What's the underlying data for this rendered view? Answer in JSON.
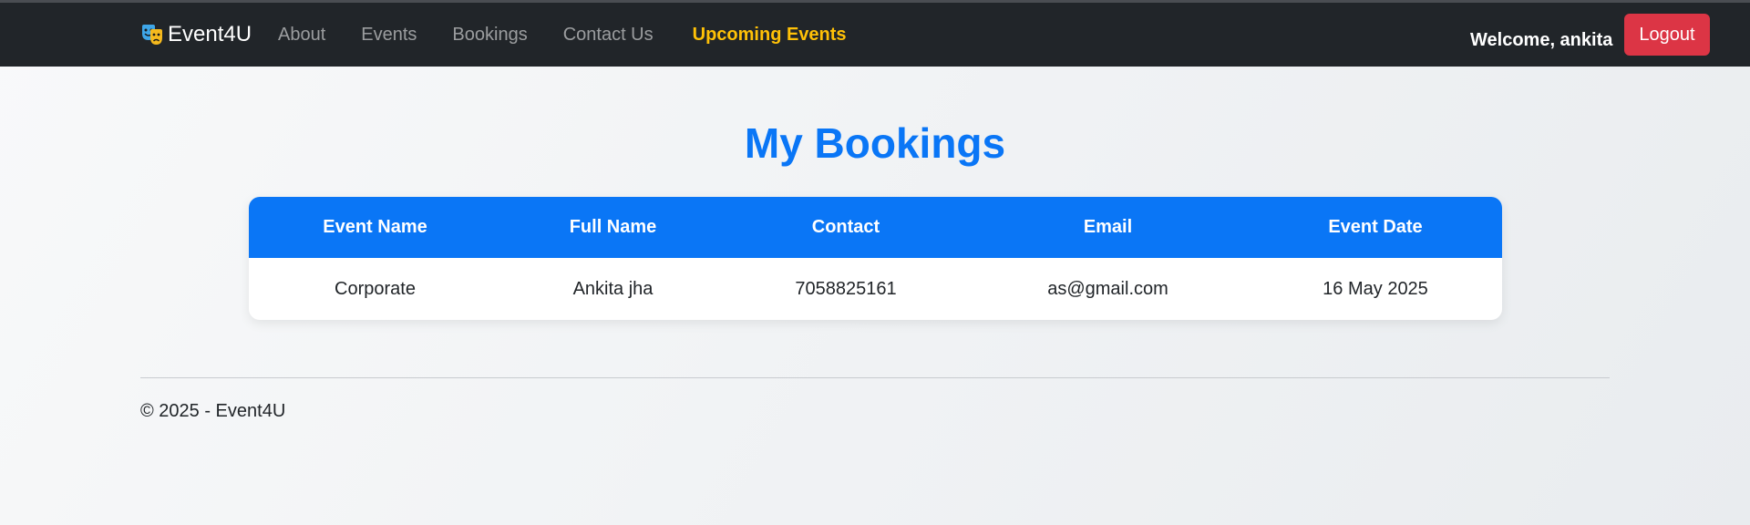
{
  "navbar": {
    "brand": "Event4U",
    "brand_icon": "theater-masks-icon",
    "links": [
      {
        "label": "About"
      },
      {
        "label": "Events"
      },
      {
        "label": "Bookings"
      },
      {
        "label": "Contact Us"
      }
    ],
    "highlight_link": "Upcoming Events",
    "welcome": "Welcome, ankita",
    "logout_label": "Logout"
  },
  "main": {
    "title": "My Bookings",
    "table": {
      "headers": [
        "Event Name",
        "Full Name",
        "Contact",
        "Email",
        "Event Date"
      ],
      "rows": [
        [
          "Corporate",
          "Ankita jha",
          "7058825161",
          "as@gmail.com",
          "16 May 2025"
        ]
      ]
    }
  },
  "footer": {
    "text": "© 2025 - Event4U"
  },
  "colors": {
    "navbar_bg": "#212529",
    "accent_blue": "#0a76f6",
    "highlight_yellow": "#ffc107",
    "logout_red": "#dc3545"
  }
}
